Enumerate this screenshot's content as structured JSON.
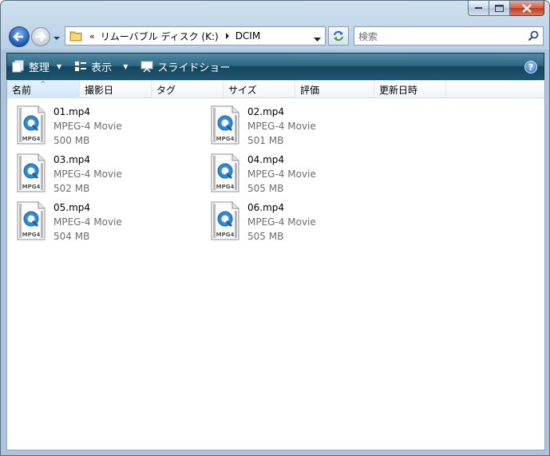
{
  "window": {
    "caption_buttons": [
      "minimize",
      "maximize",
      "close"
    ],
    "accent_colors": {
      "toolbar": "#1d5670",
      "close": "#c03a1f",
      "sort_column": "#cfe7f8"
    }
  },
  "nav": {
    "breadcrumb": [
      "«",
      "リムーバブル ディスク (K:)",
      "DCIM"
    ],
    "search_placeholder": "検索"
  },
  "toolbar": {
    "organize_label": "整理",
    "views_label": "表示",
    "slideshow_label": "スライドショー"
  },
  "columns": [
    "名前",
    "撮影日",
    "タグ",
    "サイズ",
    "評価",
    "更新日時"
  ],
  "sorted_column": "名前",
  "files": [
    {
      "name": "01.mp4",
      "type": "MPEG-4 Movie",
      "size": "500 MB",
      "icon_label": "MPG4"
    },
    {
      "name": "02.mp4",
      "type": "MPEG-4 Movie",
      "size": "501 MB",
      "icon_label": "MPG4"
    },
    {
      "name": "03.mp4",
      "type": "MPEG-4 Movie",
      "size": "502 MB",
      "icon_label": "MPG4"
    },
    {
      "name": "04.mp4",
      "type": "MPEG-4 Movie",
      "size": "505 MB",
      "icon_label": "MPG4"
    },
    {
      "name": "05.mp4",
      "type": "MPEG-4 Movie",
      "size": "504 MB",
      "icon_label": "MPG4"
    },
    {
      "name": "06.mp4",
      "type": "MPEG-4 Movie",
      "size": "505 MB",
      "icon_label": "MPG4"
    }
  ]
}
